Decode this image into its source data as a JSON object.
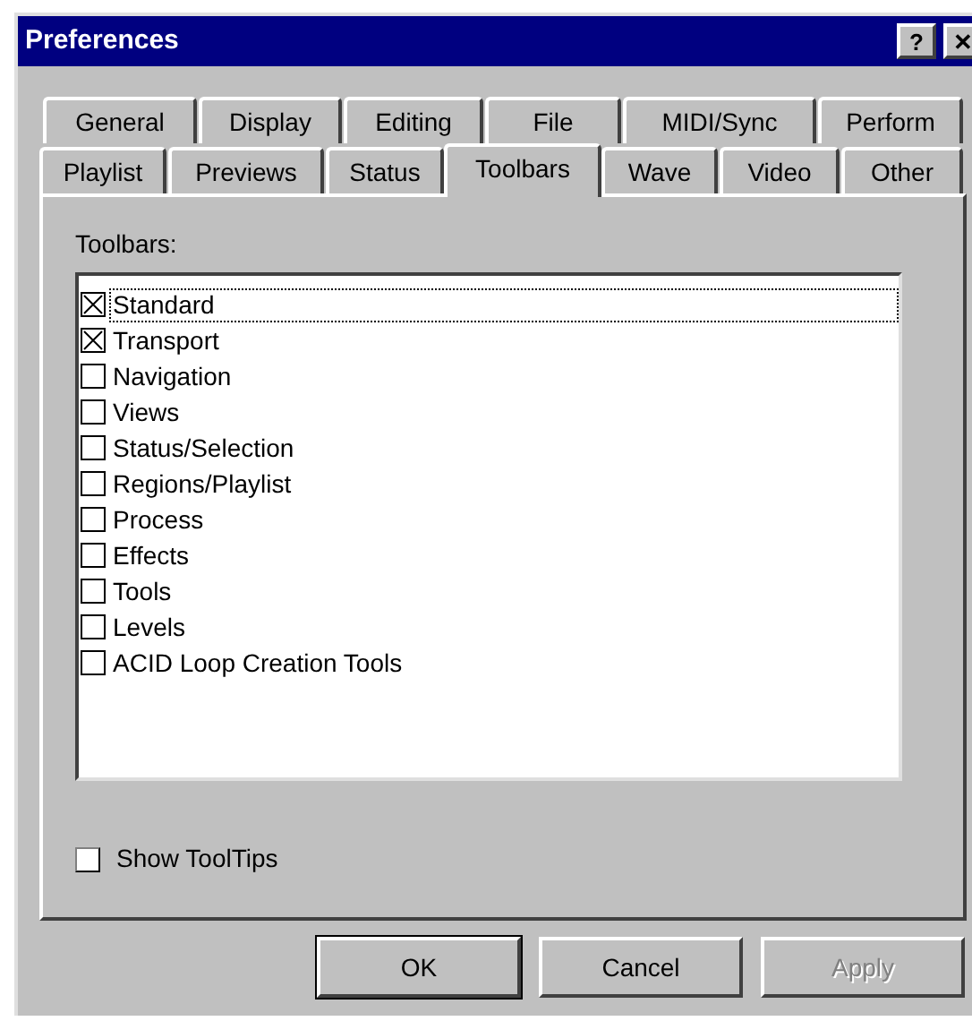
{
  "window": {
    "title": "Preferences",
    "help_button": "?",
    "close_button": "✕"
  },
  "tab_rows": [
    [
      {
        "label": "General",
        "selected": false
      },
      {
        "label": "Display",
        "selected": false
      },
      {
        "label": "Editing",
        "selected": false
      },
      {
        "label": "File",
        "selected": false
      },
      {
        "label": "MIDI/Sync",
        "selected": false
      },
      {
        "label": "Perform",
        "selected": false
      }
    ],
    [
      {
        "label": "Playlist",
        "selected": false
      },
      {
        "label": "Previews",
        "selected": false
      },
      {
        "label": "Status",
        "selected": false
      },
      {
        "label": "Toolbars",
        "selected": true
      },
      {
        "label": "Wave",
        "selected": false
      },
      {
        "label": "Video",
        "selected": false
      },
      {
        "label": "Other",
        "selected": false
      }
    ]
  ],
  "toolbars": {
    "label": "Toolbars:",
    "items": [
      {
        "label": "Standard",
        "checked": true,
        "focused": true
      },
      {
        "label": "Transport",
        "checked": true,
        "focused": false
      },
      {
        "label": "Navigation",
        "checked": false,
        "focused": false
      },
      {
        "label": "Views",
        "checked": false,
        "focused": false
      },
      {
        "label": "Status/Selection",
        "checked": false,
        "focused": false
      },
      {
        "label": "Regions/Playlist",
        "checked": false,
        "focused": false
      },
      {
        "label": "Process",
        "checked": false,
        "focused": false
      },
      {
        "label": "Effects",
        "checked": false,
        "focused": false
      },
      {
        "label": "Tools",
        "checked": false,
        "focused": false
      },
      {
        "label": "Levels",
        "checked": false,
        "focused": false
      },
      {
        "label": "ACID Loop Creation Tools",
        "checked": false,
        "focused": false
      }
    ]
  },
  "show_tooltips": {
    "label": "Show ToolTips",
    "checked": false
  },
  "buttons": [
    {
      "label": "OK",
      "disabled": false,
      "default": true
    },
    {
      "label": "Cancel",
      "disabled": false,
      "default": false
    },
    {
      "label": "Apply",
      "disabled": true,
      "default": false
    }
  ]
}
